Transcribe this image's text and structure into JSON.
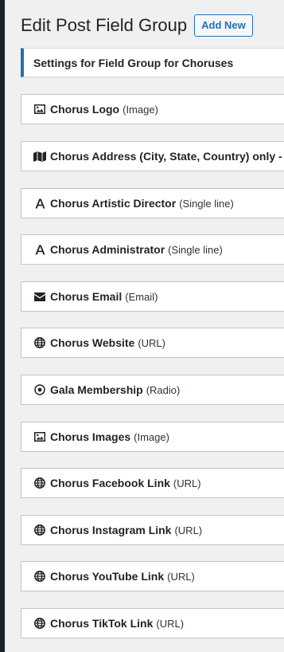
{
  "header": {
    "title": "Edit Post Field Group",
    "add_new_label": "Add New"
  },
  "notice": {
    "text": "Settings for Field Group for Choruses"
  },
  "fields": [
    {
      "name": "Chorus Logo",
      "type": "(Image)",
      "icon": "image-icon"
    },
    {
      "name": "Chorus Address (City, State, Country) only -",
      "type": "",
      "icon": "map-icon"
    },
    {
      "name": "Chorus Artistic Director",
      "type": "(Single line)",
      "icon": "text-icon"
    },
    {
      "name": "Chorus Administrator",
      "type": "(Single line)",
      "icon": "text-icon"
    },
    {
      "name": "Chorus Email",
      "type": "(Email)",
      "icon": "envelope-icon"
    },
    {
      "name": "Chorus Website",
      "type": "(URL)",
      "icon": "globe-icon"
    },
    {
      "name": "Gala Membership",
      "type": "(Radio)",
      "icon": "radio-icon"
    },
    {
      "name": "Chorus Images",
      "type": "(Image)",
      "icon": "image-icon"
    },
    {
      "name": "Chorus Facebook Link",
      "type": "(URL)",
      "icon": "globe-icon"
    },
    {
      "name": "Chorus Instagram Link",
      "type": "(URL)",
      "icon": "globe-icon"
    },
    {
      "name": "Chorus YouTube Link",
      "type": "(URL)",
      "icon": "globe-icon"
    },
    {
      "name": "Chorus TikTok Link",
      "type": "(URL)",
      "icon": "globe-icon"
    }
  ]
}
